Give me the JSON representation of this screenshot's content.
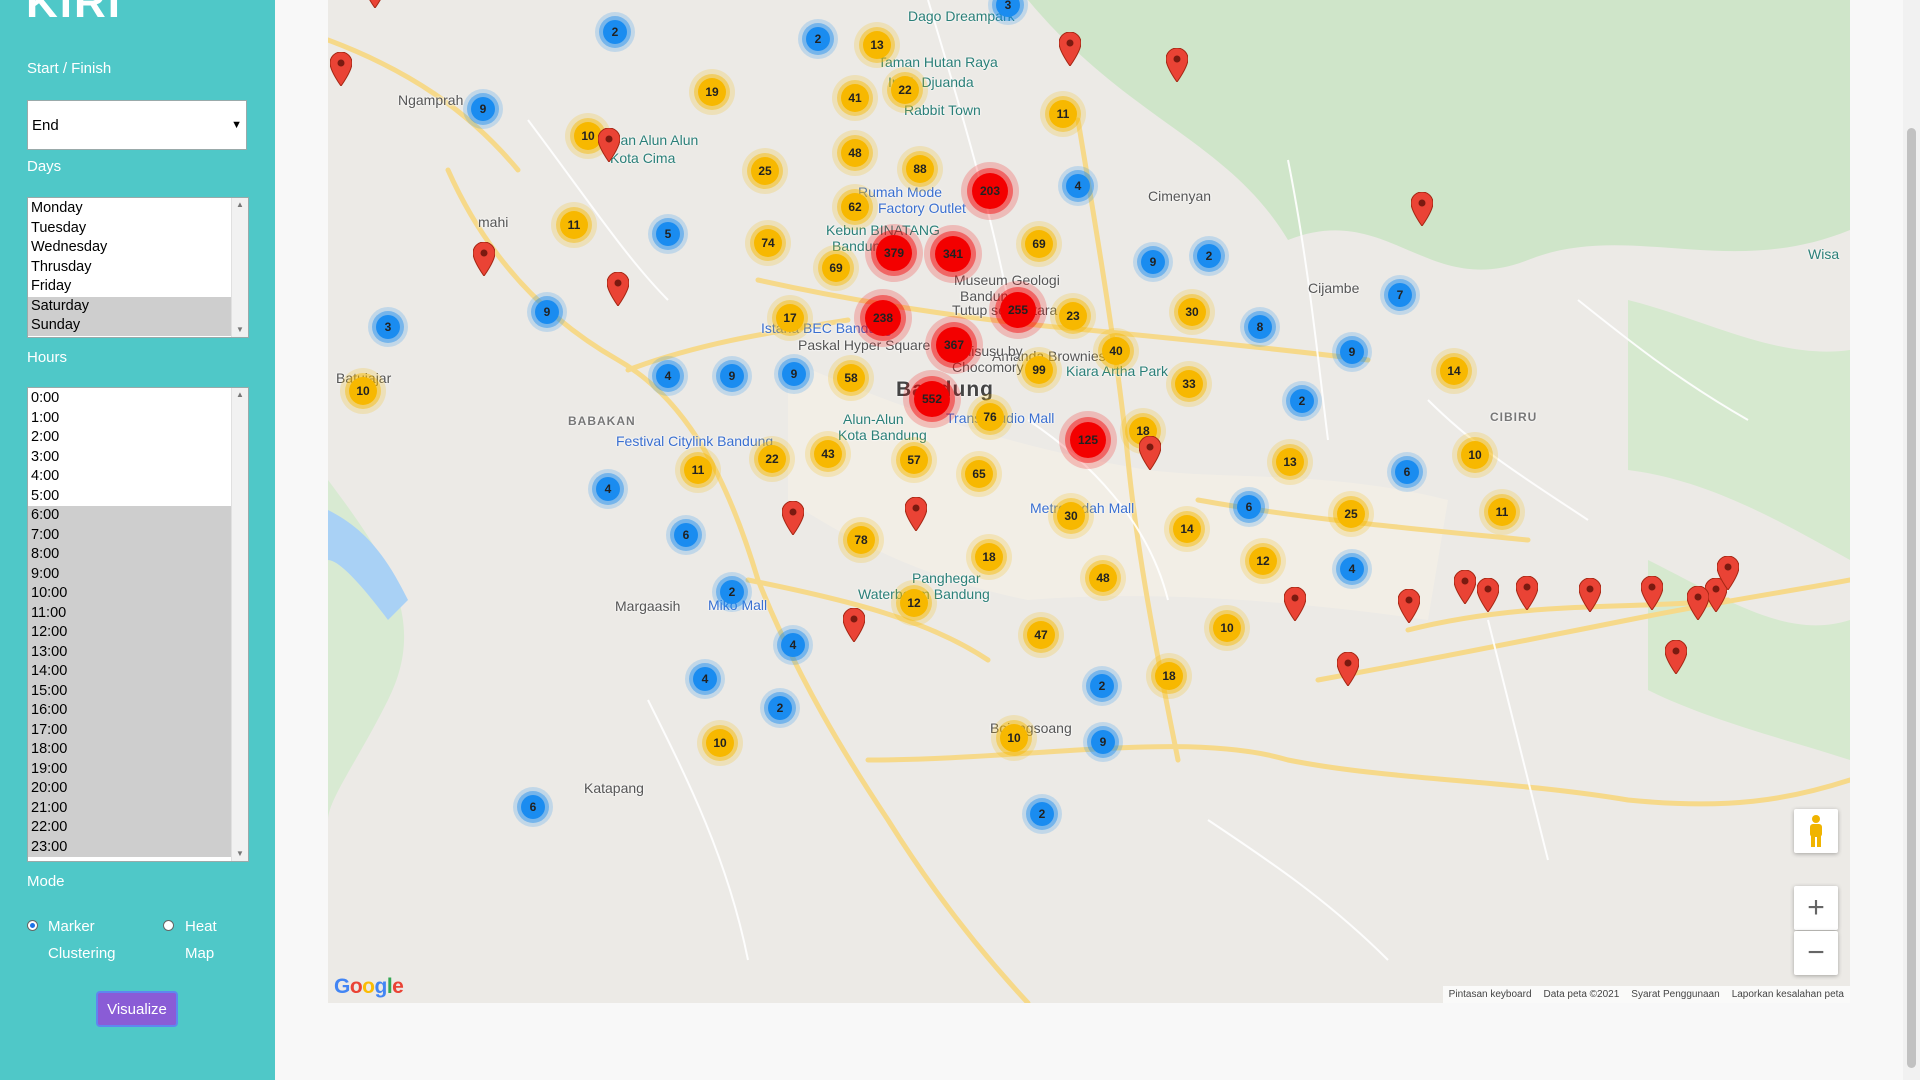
{
  "app": {
    "title": "KIRI"
  },
  "form": {
    "start_finish_label": "Start / Finish",
    "start_finish_value": "End",
    "days_label": "Days",
    "days": [
      "Monday",
      "Tuesday",
      "Wednesday",
      "Thrusday",
      "Friday",
      "Saturday",
      "Sunday"
    ],
    "days_selected": [
      "Saturday",
      "Sunday"
    ],
    "hours_label": "Hours",
    "hours": [
      "0:00",
      "1:00",
      "2:00",
      "3:00",
      "4:00",
      "5:00",
      "6:00",
      "7:00",
      "8:00",
      "9:00",
      "10:00",
      "11:00",
      "12:00",
      "13:00",
      "14:00",
      "15:00",
      "16:00",
      "17:00",
      "18:00",
      "19:00",
      "20:00",
      "21:00",
      "22:00",
      "23:00"
    ],
    "hours_selected_from": "6:00",
    "mode_label": "Mode",
    "mode_options": [
      {
        "line1": "Marker",
        "line2": "Clustering",
        "checked": true
      },
      {
        "line1": "Heat",
        "line2": "Map",
        "checked": false
      }
    ],
    "visualize_label": "Visualize"
  },
  "map": {
    "places": [
      {
        "text": "Dago Dreampark",
        "cls": "poi"
      },
      {
        "text": "Taman Hutan Raya",
        "cls": "poi"
      },
      {
        "text": "Ir. H. Djuanda",
        "cls": "poi"
      },
      {
        "text": "Rabbit Town",
        "cls": "poi"
      },
      {
        "text": "Ngamprah",
        "cls": ""
      },
      {
        "text": "Taman Alun Alun",
        "cls": "poi"
      },
      {
        "text": "Kota Cima",
        "cls": "poi"
      },
      {
        "text": "Rumah Mode",
        "cls": "shop"
      },
      {
        "text": "Factory Outlet",
        "cls": "shop"
      },
      {
        "text": "Cimenyan",
        "cls": ""
      },
      {
        "text": "Kebun BINATANG",
        "cls": "poi"
      },
      {
        "text": "Bandung",
        "cls": "poi"
      },
      {
        "text": "mahi",
        "cls": ""
      },
      {
        "text": "Museum Geologi",
        "cls": ""
      },
      {
        "text": "Bandung",
        "cls": ""
      },
      {
        "text": "Tutup sementara",
        "cls": ""
      },
      {
        "text": "Istana BEC Bandung",
        "cls": "shop"
      },
      {
        "text": "Paskal Hyper Square",
        "cls": ""
      },
      {
        "text": "Amanda Brownies",
        "cls": ""
      },
      {
        "text": "Tiramisusu by",
        "cls": ""
      },
      {
        "text": "Chocomory",
        "cls": ""
      },
      {
        "text": "Kiara Artha Park",
        "cls": "poi"
      },
      {
        "text": "Batujajar",
        "cls": ""
      },
      {
        "text": "Bandung",
        "cls": "big"
      },
      {
        "text": "BABAKAN",
        "cls": "area"
      },
      {
        "text": "Trans Studio Mall",
        "cls": "shop"
      },
      {
        "text": "Alun-Alun",
        "cls": "poi"
      },
      {
        "text": "Kota Bandung",
        "cls": "poi"
      },
      {
        "text": "Festival Citylink Bandung",
        "cls": "shop"
      },
      {
        "text": "CIBIRU",
        "cls": "area"
      },
      {
        "text": "Metro Indah Mall",
        "cls": "shop"
      },
      {
        "text": "Cijambe",
        "cls": ""
      },
      {
        "text": "Wisa",
        "cls": "poi"
      },
      {
        "text": "Panghegar",
        "cls": "poi"
      },
      {
        "text": "Waterboom Bandung",
        "cls": "poi"
      },
      {
        "text": "Margaasih",
        "cls": ""
      },
      {
        "text": "Miko Mall",
        "cls": "shop"
      },
      {
        "text": "Bojongsoang",
        "cls": ""
      },
      {
        "text": "Katapang",
        "cls": ""
      }
    ],
    "clusters": [
      {
        "n": "2",
        "c": "blue"
      },
      {
        "n": "2",
        "c": "blue"
      },
      {
        "n": "13",
        "c": "yellow"
      },
      {
        "n": "3",
        "c": "blue"
      },
      {
        "n": "22",
        "c": "yellow"
      },
      {
        "n": "9",
        "c": "blue"
      },
      {
        "n": "19",
        "c": "yellow"
      },
      {
        "n": "41",
        "c": "yellow"
      },
      {
        "n": "11",
        "c": "yellow"
      },
      {
        "n": "10",
        "c": "yellow"
      },
      {
        "n": "48",
        "c": "yellow"
      },
      {
        "n": "25",
        "c": "yellow"
      },
      {
        "n": "88",
        "c": "yellow"
      },
      {
        "n": "203",
        "c": "red"
      },
      {
        "n": "4",
        "c": "blue"
      },
      {
        "n": "11",
        "c": "yellow"
      },
      {
        "n": "5",
        "c": "blue"
      },
      {
        "n": "62",
        "c": "yellow"
      },
      {
        "n": "74",
        "c": "yellow"
      },
      {
        "n": "379",
        "c": "red"
      },
      {
        "n": "341",
        "c": "red"
      },
      {
        "n": "69",
        "c": "yellow"
      },
      {
        "n": "69",
        "c": "yellow"
      },
      {
        "n": "9",
        "c": "blue"
      },
      {
        "n": "2",
        "c": "blue"
      },
      {
        "n": "9",
        "c": "blue"
      },
      {
        "n": "7",
        "c": "blue"
      },
      {
        "n": "3",
        "c": "blue"
      },
      {
        "n": "238",
        "c": "red"
      },
      {
        "n": "255",
        "c": "red"
      },
      {
        "n": "23",
        "c": "yellow"
      },
      {
        "n": "30",
        "c": "yellow"
      },
      {
        "n": "8",
        "c": "blue"
      },
      {
        "n": "17",
        "c": "yellow"
      },
      {
        "n": "367",
        "c": "red"
      },
      {
        "n": "40",
        "c": "yellow"
      },
      {
        "n": "9",
        "c": "blue"
      },
      {
        "n": "4",
        "c": "blue"
      },
      {
        "n": "9",
        "c": "blue"
      },
      {
        "n": "9",
        "c": "blue"
      },
      {
        "n": "58",
        "c": "yellow"
      },
      {
        "n": "99",
        "c": "yellow"
      },
      {
        "n": "33",
        "c": "yellow"
      },
      {
        "n": "14",
        "c": "yellow"
      },
      {
        "n": "10",
        "c": "yellow"
      },
      {
        "n": "552",
        "c": "red"
      },
      {
        "n": "76",
        "c": "yellow"
      },
      {
        "n": "2",
        "c": "blue"
      },
      {
        "n": "18",
        "c": "yellow"
      },
      {
        "n": "125",
        "c": "red"
      },
      {
        "n": "22",
        "c": "yellow"
      },
      {
        "n": "43",
        "c": "yellow"
      },
      {
        "n": "57",
        "c": "yellow"
      },
      {
        "n": "11",
        "c": "yellow"
      },
      {
        "n": "65",
        "c": "yellow"
      },
      {
        "n": "13",
        "c": "yellow"
      },
      {
        "n": "6",
        "c": "blue"
      },
      {
        "n": "10",
        "c": "yellow"
      },
      {
        "n": "4",
        "c": "blue"
      },
      {
        "n": "30",
        "c": "yellow"
      },
      {
        "n": "6",
        "c": "blue"
      },
      {
        "n": "25",
        "c": "yellow"
      },
      {
        "n": "11",
        "c": "yellow"
      },
      {
        "n": "14",
        "c": "yellow"
      },
      {
        "n": "6",
        "c": "blue"
      },
      {
        "n": "78",
        "c": "yellow"
      },
      {
        "n": "18",
        "c": "yellow"
      },
      {
        "n": "12",
        "c": "yellow"
      },
      {
        "n": "2",
        "c": "blue"
      },
      {
        "n": "48",
        "c": "yellow"
      },
      {
        "n": "4",
        "c": "blue"
      },
      {
        "n": "12",
        "c": "yellow"
      },
      {
        "n": "10",
        "c": "yellow"
      },
      {
        "n": "4",
        "c": "blue"
      },
      {
        "n": "47",
        "c": "yellow"
      },
      {
        "n": "4",
        "c": "blue"
      },
      {
        "n": "2",
        "c": "blue"
      },
      {
        "n": "18",
        "c": "yellow"
      },
      {
        "n": "2",
        "c": "blue"
      },
      {
        "n": "10",
        "c": "yellow"
      },
      {
        "n": "10",
        "c": "yellow"
      },
      {
        "n": "9",
        "c": "blue"
      },
      {
        "n": "6",
        "c": "blue"
      },
      {
        "n": "2",
        "c": "blue"
      }
    ],
    "pin_count": 24,
    "colors": {
      "blue_cluster": "#1a8cf0",
      "yellow_cluster": "#f7b800",
      "red_cluster": "#f30000",
      "pin": "#ea4335",
      "sidebar": "#4fc8c8",
      "button": "#8a5cd6"
    },
    "google_logo": "Google",
    "attribution": [
      "Pintasan keyboard",
      "Data peta ©2021",
      "Syarat Penggunaan",
      "Laporkan kesalahan peta"
    ],
    "controls": {
      "zoom_in": "+",
      "zoom_out": "−",
      "street_view": "pegman-icon"
    }
  }
}
